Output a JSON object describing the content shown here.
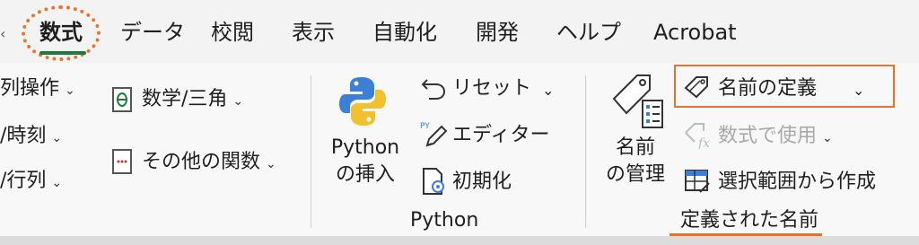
{
  "tabs": [
    {
      "label": "数式",
      "active": true
    },
    {
      "label": "データ"
    },
    {
      "label": "校閲"
    },
    {
      "label": "表示"
    },
    {
      "label": "自動化"
    },
    {
      "label": "開発"
    },
    {
      "label": "ヘルプ"
    },
    {
      "label": "Acrobat"
    }
  ],
  "functions": {
    "col1": [
      "列操作",
      "/時刻",
      "/行列"
    ],
    "math_trig": "数学/三角",
    "other_functions": "その他の関数"
  },
  "python": {
    "insert_line1": "Python",
    "insert_line2": "の挿入",
    "reset": "リセット",
    "editor": "エディター",
    "initialize": "初期化",
    "group_label": "Python"
  },
  "defined_names": {
    "name_manager_line1": "名前",
    "name_manager_line2": "の管理",
    "define_name": "名前の定義",
    "use_in_formula": "数式で使用",
    "create_from_selection": "選択範囲から作成",
    "group_label": "定義された名前"
  },
  "colors": {
    "accent_orange": "#e8742a",
    "active_tab_underline": "#1f7a3f",
    "python_blue": "#3b7fd6",
    "python_yellow": "#f2c12e"
  }
}
